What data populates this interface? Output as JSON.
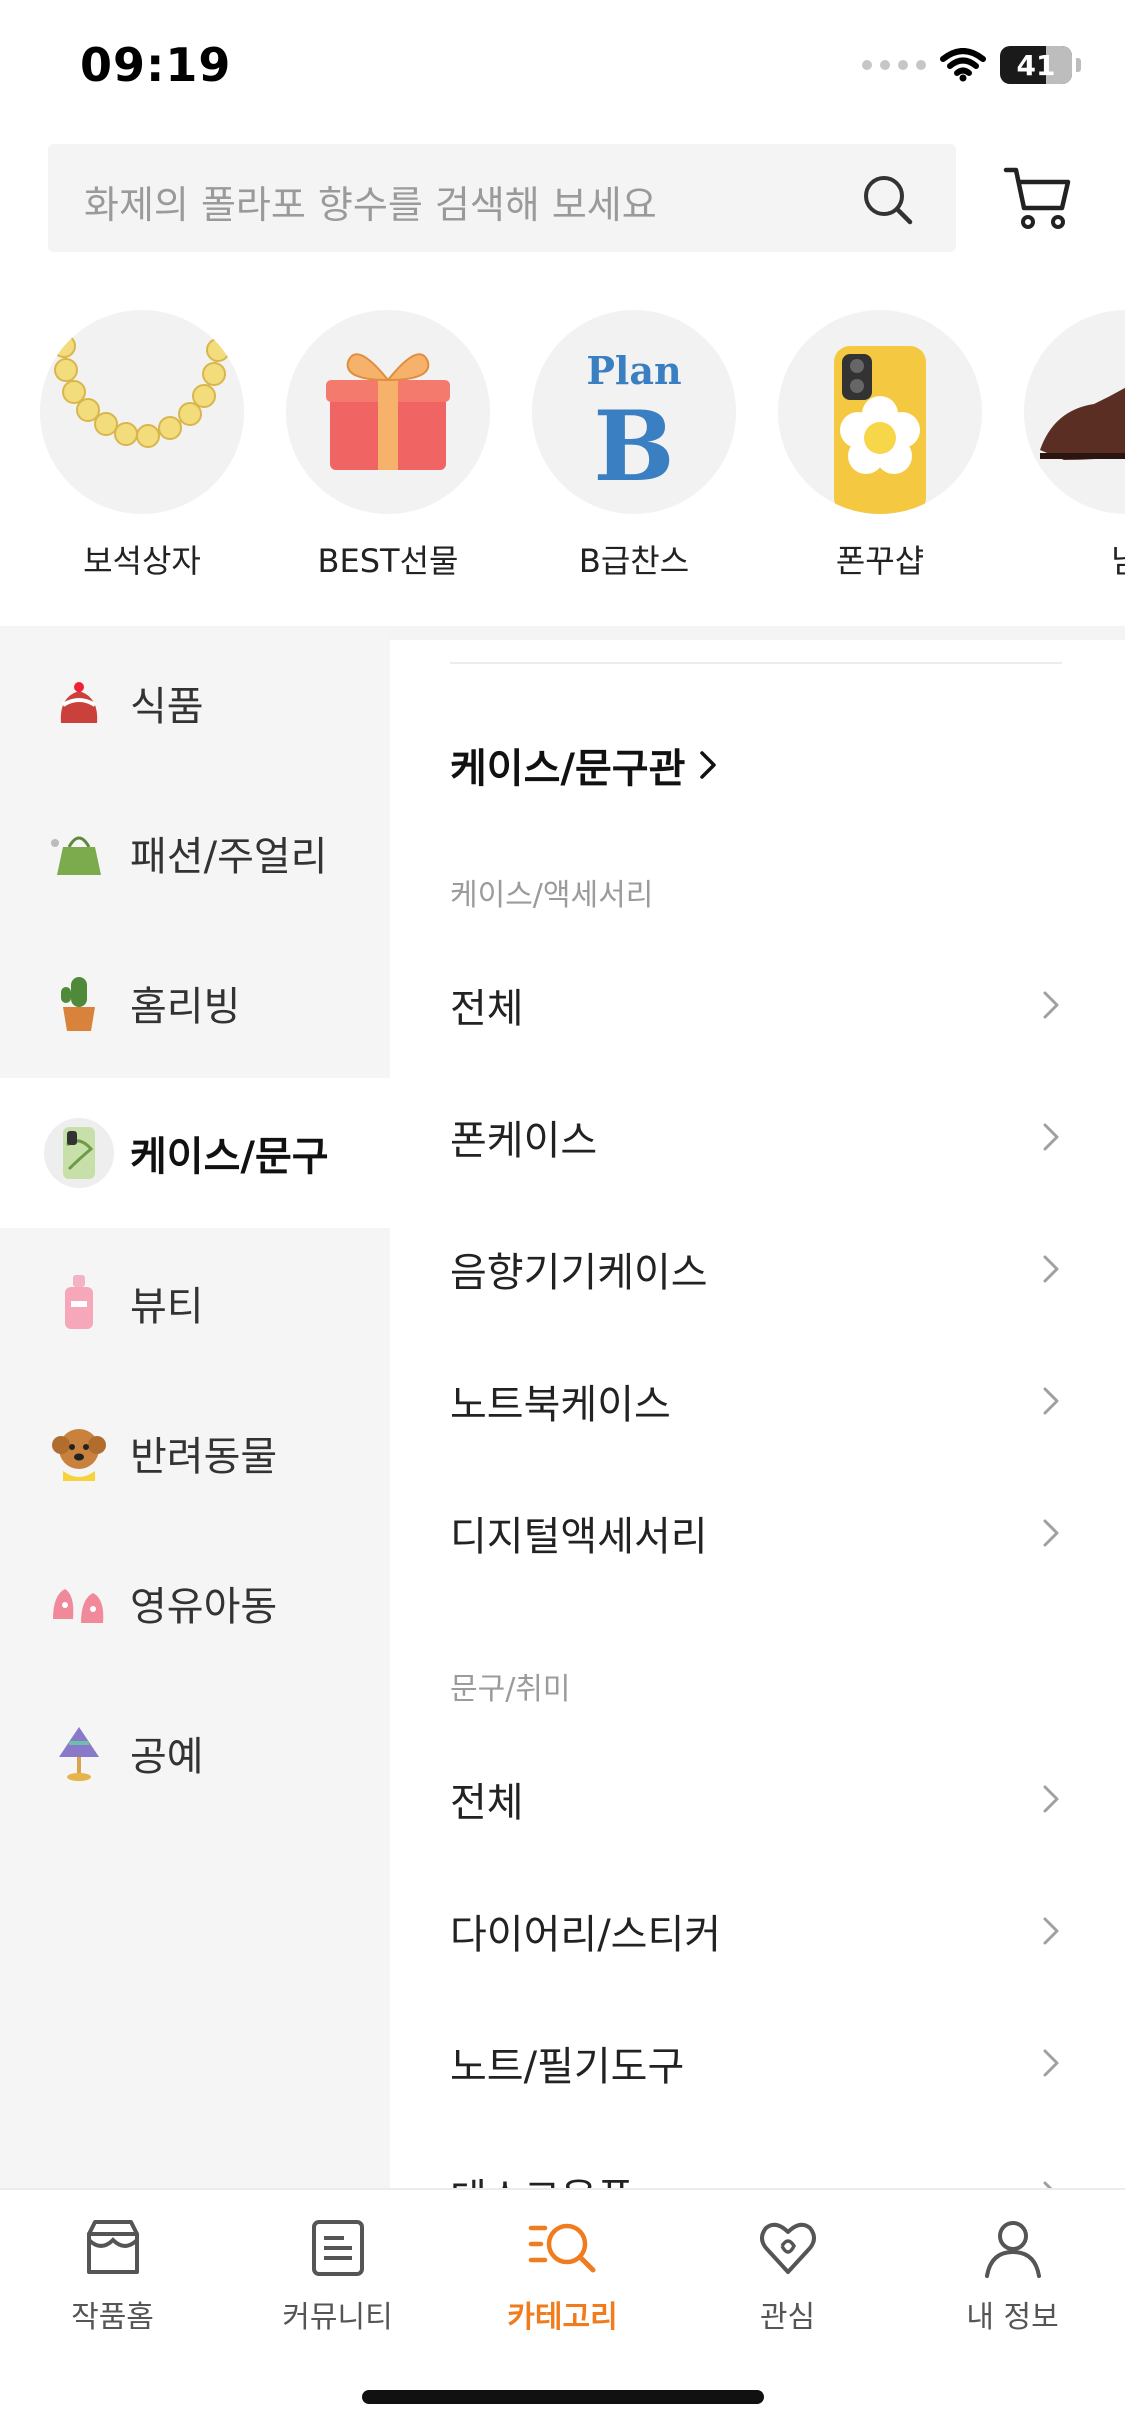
{
  "status": {
    "time": "09:19",
    "battery": "41"
  },
  "search": {
    "placeholder": "화제의 폴라포 향수를 검색해 보세요"
  },
  "quick_categories": [
    {
      "label": "보석상자",
      "icon": "necklace-icon"
    },
    {
      "label": "BEST선물",
      "icon": "gift-box-icon"
    },
    {
      "label": "B급찬스",
      "icon": "plan-b-logo",
      "logo_text_top": "Plan",
      "logo_text_bottom": "B"
    },
    {
      "label": "폰꾸샵",
      "icon": "phone-case-icon"
    },
    {
      "label": "남",
      "icon": "shoe-icon"
    }
  ],
  "categories": [
    {
      "label": "식품",
      "icon": "cake-icon"
    },
    {
      "label": "패션/주얼리",
      "icon": "handbag-icon"
    },
    {
      "label": "홈리빙",
      "icon": "cactus-pot-icon"
    },
    {
      "label": "케이스/문구",
      "icon": "phone-case-icon",
      "active": true
    },
    {
      "label": "뷰티",
      "icon": "perfume-icon"
    },
    {
      "label": "반려동물",
      "icon": "dog-icon"
    },
    {
      "label": "영유아동",
      "icon": "baby-shoes-icon"
    },
    {
      "label": "공예",
      "icon": "lamp-icon"
    }
  ],
  "detail": {
    "title": "케이스/문구관",
    "groups": [
      {
        "label": "케이스/액세서리",
        "items": [
          "전체",
          "폰케이스",
          "음향기기케이스",
          "노트북케이스",
          "디지털액세서리"
        ]
      },
      {
        "label": "문구/취미",
        "items": [
          "전체",
          "다이어리/스티커",
          "노트/필기도구",
          "데스크용품"
        ]
      }
    ]
  },
  "tabs": [
    {
      "label": "작품홈",
      "icon": "store-icon"
    },
    {
      "label": "커뮤니티",
      "icon": "community-icon"
    },
    {
      "label": "카테고리",
      "icon": "category-search-icon",
      "active": true
    },
    {
      "label": "관심",
      "icon": "heart-icon"
    },
    {
      "label": "내 정보",
      "icon": "profile-icon"
    }
  ],
  "colors": {
    "accent": "#f07c1e",
    "panel_bg": "#f5f5f5",
    "planb_blue": "#3a7fc1"
  }
}
